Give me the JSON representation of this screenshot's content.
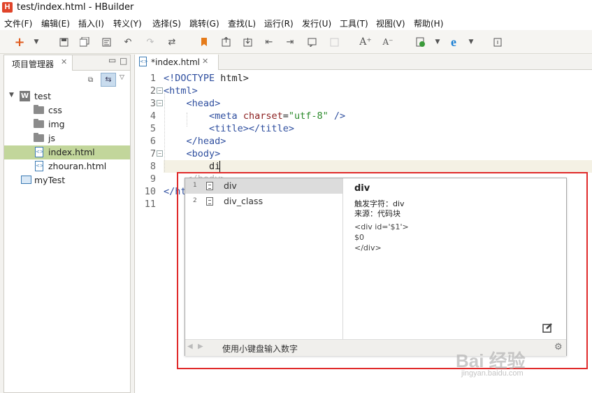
{
  "window": {
    "logo": "H",
    "title": "test/index.html  -  HBuilder"
  },
  "menu": [
    "文件(F)",
    "编辑(E)",
    "插入(I)",
    "转义(Y)",
    "选择(S)",
    "跳转(G)",
    "查找(L)",
    "运行(R)",
    "发行(U)",
    "工具(T)",
    "视图(V)",
    "帮助(H)"
  ],
  "toolbar_icons": [
    "new-icon",
    "dropdown-icon",
    "save-icon",
    "save-all-icon",
    "format-icon",
    "undo-icon",
    "redo-icon",
    "find-icon",
    "bookmark-icon",
    "goto-icon",
    "export-icon",
    "indent-left-icon",
    "indent-right-icon",
    "comment-icon",
    "disabled-icon",
    "font-bigger-icon",
    "font-smaller-icon",
    "run-icon",
    "dropdown-icon",
    "browser-icon",
    "dropdown-icon",
    "info-icon"
  ],
  "project_panel": {
    "title": "项目管理器",
    "tree": [
      {
        "label": "test",
        "type": "project",
        "expanded": true
      },
      {
        "label": "css",
        "type": "folder"
      },
      {
        "label": "img",
        "type": "folder"
      },
      {
        "label": "js",
        "type": "folder"
      },
      {
        "label": "index.html",
        "type": "file",
        "selected": true
      },
      {
        "label": "zhouran.html",
        "type": "file"
      },
      {
        "label": "myTest",
        "type": "project"
      }
    ]
  },
  "editor": {
    "tab_label": "*index.html",
    "line_numbers": [
      "1",
      "2",
      "3",
      "4",
      "5",
      "6",
      "7",
      "8",
      "9",
      "10",
      "11"
    ],
    "typed_text": "di"
  },
  "autocomplete": {
    "items": [
      {
        "num": "1",
        "label": "div",
        "selected": true
      },
      {
        "num": "2",
        "label": "div_class",
        "selected": false
      }
    ],
    "detail_title": "div",
    "trigger_label": "触发字符：div",
    "source_label": "来源：代码块",
    "snippet": [
      "<div id='$1'>",
      "$0",
      "</div>"
    ],
    "footer_hint": "使用小键盘输入数字"
  },
  "watermark": {
    "main": "Bai 经验",
    "sub": "jingyan.baidu.com"
  },
  "colors": {
    "highlight": "#e02a2a",
    "tag": "#2f4f9f",
    "attr": "#8a1d1d",
    "string": "#2a8a2a",
    "selection": "#c2d69b"
  }
}
